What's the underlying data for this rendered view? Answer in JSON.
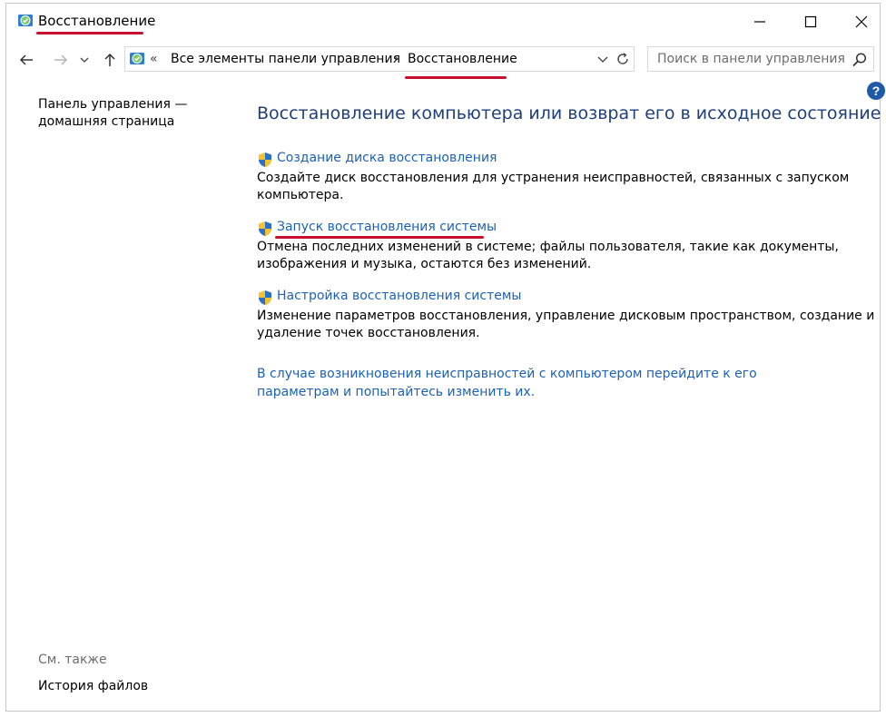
{
  "window": {
    "title": "Восстановление"
  },
  "nav": {
    "breadcrumb_root_chevron": "«",
    "breadcrumb_parent": "Все элементы панели управления",
    "breadcrumb_separator": "›",
    "breadcrumb_current": "Восстановление",
    "search_placeholder": "Поиск в панели управления"
  },
  "left_pane": {
    "home_link": "Панель управления — домашняя страница",
    "see_also_label": "См. также",
    "file_history_link": "История файлов"
  },
  "main": {
    "heading": "Восстановление компьютера или возврат его в исходное состояние",
    "tasks": [
      {
        "link": "Создание диска восстановления",
        "description": "Создайте диск восстановления для устранения неисправностей, связанных с запуском компьютера."
      },
      {
        "link": "Запуск восстановления системы",
        "description": "Отмена последних изменений в системе; файлы пользователя, такие как документы, изображения и музыка, остаются без изменений."
      },
      {
        "link": "Настройка восстановления системы",
        "description": "Изменение параметров восстановления, управление дисковым пространством, создание и удаление точек восстановления."
      }
    ],
    "troubleshoot_link": "В случае возникновения неисправностей с компьютером перейдите к его параметрам и попытайтесь изменить их."
  },
  "colors": {
    "link": "#1c61b5",
    "heading": "#1e3f7a",
    "annotation": "#c8102e"
  }
}
